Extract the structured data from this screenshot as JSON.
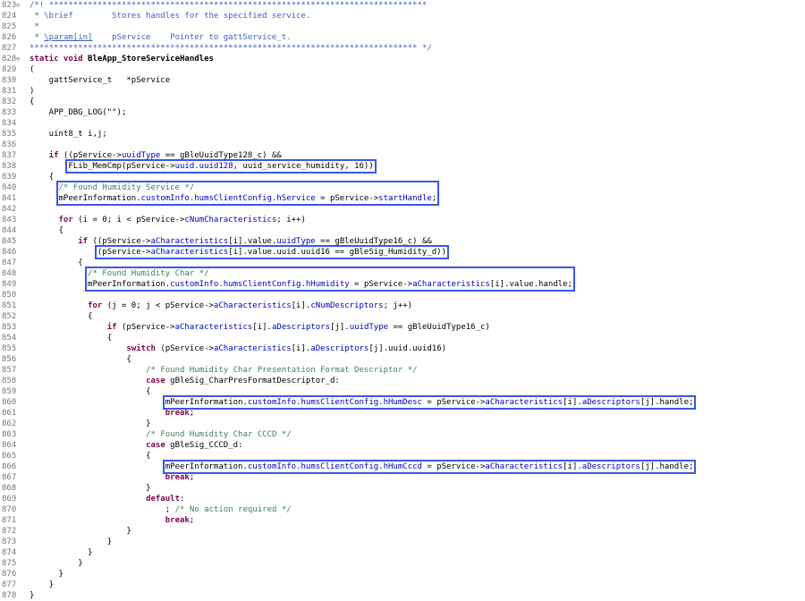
{
  "editor": {
    "lines": [
      {
        "n": "823",
        "fold": true,
        "indent": 0,
        "tokens": [
          {
            "t": "/*! ******************************************************************************",
            "c": "cmb"
          }
        ]
      },
      {
        "n": "824",
        "indent": 0,
        "tokens": [
          {
            "t": " * \\brief        Stores handles for the specified service.",
            "c": "cmb"
          }
        ]
      },
      {
        "n": "825",
        "indent": 0,
        "tokens": [
          {
            "t": " *",
            "c": "cmb"
          }
        ]
      },
      {
        "n": "826",
        "indent": 0,
        "tokens": [
          {
            "t": " * ",
            "c": "cmb"
          },
          {
            "t": "\\param[in]",
            "c": "cmb ul"
          },
          {
            "t": "    pService    Pointer to gattService_t.",
            "c": "cmb"
          }
        ]
      },
      {
        "n": "827",
        "indent": 0,
        "tokens": [
          {
            "t": "******************************************************************************** */",
            "c": "cmb"
          }
        ]
      },
      {
        "n": "828",
        "fold": true,
        "indent": 0,
        "tokens": [
          {
            "t": "static void ",
            "c": "kw"
          },
          {
            "t": "BleApp_StoreServiceHandles",
            "c": "bld"
          }
        ]
      },
      {
        "n": "829",
        "indent": 0,
        "tokens": [
          {
            "t": "("
          }
        ]
      },
      {
        "n": "830",
        "indent": 4,
        "tokens": [
          {
            "t": "gattService_t   *pService"
          }
        ]
      },
      {
        "n": "831",
        "indent": 0,
        "tokens": [
          {
            "t": ")"
          }
        ]
      },
      {
        "n": "832",
        "indent": 0,
        "tokens": [
          {
            "t": "{"
          }
        ]
      },
      {
        "n": "833",
        "indent": 4,
        "tokens": [
          {
            "t": "APP_DBG_LOG(\"\");"
          }
        ]
      },
      {
        "n": "834",
        "indent": 0,
        "tokens": []
      },
      {
        "n": "835",
        "indent": 4,
        "tokens": [
          {
            "t": "uint8_t i,j;"
          }
        ]
      },
      {
        "n": "836",
        "indent": 0,
        "tokens": []
      },
      {
        "n": "837",
        "indent": 4,
        "tokens": [
          {
            "t": "if",
            "c": "kw"
          },
          {
            "t": " ((pService->"
          },
          {
            "t": "uuidType",
            "c": "fld"
          },
          {
            "t": " == gBleUuidType128_c) &&"
          }
        ]
      },
      {
        "n": "838",
        "indent": 8,
        "tokens": [
          {
            "t": "FLib_MemCmp(pService->"
          },
          {
            "t": "uuid.uuid128",
            "c": "fld"
          },
          {
            "t": ", uuid_service_humidity, 16))"
          }
        ]
      },
      {
        "n": "839",
        "indent": 4,
        "tokens": [
          {
            "t": "{"
          }
        ]
      },
      {
        "n": "840",
        "indent": 6,
        "tokens": [
          {
            "t": "/* Found Humidity Service */",
            "c": "cm"
          }
        ]
      },
      {
        "n": "841",
        "indent": 6,
        "tokens": [
          {
            "t": "mPeerInformation."
          },
          {
            "t": "customInfo.humsClientConfig.hService",
            "c": "fld"
          },
          {
            "t": " = pService->"
          },
          {
            "t": "startHandle",
            "c": "fld"
          },
          {
            "t": ";"
          }
        ]
      },
      {
        "n": "842",
        "indent": 0,
        "tokens": []
      },
      {
        "n": "843",
        "indent": 6,
        "tokens": [
          {
            "t": "for",
            "c": "kw"
          },
          {
            "t": " (i = 0; i < pService->"
          },
          {
            "t": "cNumCharacteristics",
            "c": "fld"
          },
          {
            "t": "; i++)"
          }
        ]
      },
      {
        "n": "844",
        "indent": 6,
        "tokens": [
          {
            "t": "{"
          }
        ]
      },
      {
        "n": "845",
        "indent": 10,
        "tokens": [
          {
            "t": "if",
            "c": "kw"
          },
          {
            "t": " ((pService->"
          },
          {
            "t": "aCharacteristics",
            "c": "fld"
          },
          {
            "t": "[i].value."
          },
          {
            "t": "uuidType",
            "c": "fld"
          },
          {
            "t": " == gBleUuidType16_c) &&"
          }
        ]
      },
      {
        "n": "846",
        "indent": 14,
        "tokens": [
          {
            "t": "(pService->"
          },
          {
            "t": "aCharacteristics",
            "c": "fld"
          },
          {
            "t": "[i].value.uuid.uuid16 == gBleSig_Humidity_d))"
          }
        ]
      },
      {
        "n": "847",
        "indent": 10,
        "tokens": [
          {
            "t": "{"
          }
        ]
      },
      {
        "n": "848",
        "indent": 12,
        "tokens": [
          {
            "t": "/* Found Humidity Char */",
            "c": "cm"
          }
        ]
      },
      {
        "n": "849",
        "indent": 12,
        "tokens": [
          {
            "t": "mPeerInformation."
          },
          {
            "t": "customInfo.humsClientConfig.hHumidity",
            "c": "fld"
          },
          {
            "t": " = pService->"
          },
          {
            "t": "aCharacteristics",
            "c": "fld"
          },
          {
            "t": "[i].value.handle;"
          }
        ]
      },
      {
        "n": "850",
        "indent": 0,
        "tokens": []
      },
      {
        "n": "851",
        "indent": 12,
        "tokens": [
          {
            "t": "for",
            "c": "kw"
          },
          {
            "t": " (j = 0; j < pService->"
          },
          {
            "t": "aCharacteristics",
            "c": "fld"
          },
          {
            "t": "[i]."
          },
          {
            "t": "cNumDescriptors",
            "c": "fld"
          },
          {
            "t": "; j++)"
          }
        ]
      },
      {
        "n": "852",
        "indent": 12,
        "tokens": [
          {
            "t": "{"
          }
        ]
      },
      {
        "n": "853",
        "indent": 16,
        "tokens": [
          {
            "t": "if",
            "c": "kw"
          },
          {
            "t": " (pService->"
          },
          {
            "t": "aCharacteristics",
            "c": "fld"
          },
          {
            "t": "[i]."
          },
          {
            "t": "aDescriptors",
            "c": "fld"
          },
          {
            "t": "[j]."
          },
          {
            "t": "uuidType",
            "c": "fld"
          },
          {
            "t": " == gBleUuidType16_c)"
          }
        ]
      },
      {
        "n": "854",
        "indent": 16,
        "tokens": [
          {
            "t": "{"
          }
        ]
      },
      {
        "n": "855",
        "indent": 20,
        "tokens": [
          {
            "t": "switch",
            "c": "kw"
          },
          {
            "t": " (pService->"
          },
          {
            "t": "aCharacteristics",
            "c": "fld"
          },
          {
            "t": "[i]."
          },
          {
            "t": "aDescriptors",
            "c": "fld"
          },
          {
            "t": "[j].uuid.uuid16)"
          }
        ]
      },
      {
        "n": "856",
        "indent": 20,
        "tokens": [
          {
            "t": "{"
          }
        ]
      },
      {
        "n": "857",
        "indent": 24,
        "tokens": [
          {
            "t": "/* Found Humidity Char Presentation Format Descriptor */",
            "c": "cm"
          }
        ]
      },
      {
        "n": "858",
        "indent": 24,
        "tokens": [
          {
            "t": "case",
            "c": "kw"
          },
          {
            "t": " gBleSig_CharPresFormatDescriptor_d:"
          }
        ]
      },
      {
        "n": "859",
        "indent": 24,
        "tokens": [
          {
            "t": "{"
          }
        ]
      },
      {
        "n": "860",
        "indent": 28,
        "tokens": [
          {
            "t": "mPeerInformation."
          },
          {
            "t": "customInfo.humsClientConfig.hHumDesc",
            "c": "fld"
          },
          {
            "t": " = pService->"
          },
          {
            "t": "aCharacteristics",
            "c": "fld"
          },
          {
            "t": "[i]."
          },
          {
            "t": "aDescriptors",
            "c": "fld"
          },
          {
            "t": "[j].handle;"
          }
        ]
      },
      {
        "n": "861",
        "indent": 28,
        "tokens": [
          {
            "t": "break",
            "c": "kw"
          },
          {
            "t": ";"
          }
        ]
      },
      {
        "n": "862",
        "indent": 24,
        "tokens": [
          {
            "t": "}"
          }
        ]
      },
      {
        "n": "863",
        "indent": 24,
        "tokens": [
          {
            "t": "/* Found Humidity Char CCCD */",
            "c": "cm"
          }
        ]
      },
      {
        "n": "864",
        "indent": 24,
        "tokens": [
          {
            "t": "case",
            "c": "kw"
          },
          {
            "t": " gBleSig_CCCD_d:"
          }
        ]
      },
      {
        "n": "865",
        "indent": 24,
        "tokens": [
          {
            "t": "{"
          }
        ]
      },
      {
        "n": "866",
        "indent": 28,
        "tokens": [
          {
            "t": "mPeerInformation."
          },
          {
            "t": "customInfo.humsClientConfig.hHumCccd",
            "c": "fld"
          },
          {
            "t": " = pService->"
          },
          {
            "t": "aCharacteristics",
            "c": "fld"
          },
          {
            "t": "[i]."
          },
          {
            "t": "aDescriptors",
            "c": "fld"
          },
          {
            "t": "[j].handle;"
          }
        ]
      },
      {
        "n": "867",
        "indent": 28,
        "tokens": [
          {
            "t": "break",
            "c": "kw"
          },
          {
            "t": ";"
          }
        ]
      },
      {
        "n": "868",
        "indent": 24,
        "tokens": [
          {
            "t": "}"
          }
        ]
      },
      {
        "n": "869",
        "indent": 24,
        "tokens": [
          {
            "t": "default",
            "c": "kw"
          },
          {
            "t": ":"
          }
        ]
      },
      {
        "n": "870",
        "indent": 28,
        "tokens": [
          {
            "t": "; "
          },
          {
            "t": "/* No action required */",
            "c": "cm"
          }
        ]
      },
      {
        "n": "871",
        "indent": 28,
        "tokens": [
          {
            "t": "break",
            "c": "kw"
          },
          {
            "t": ";"
          }
        ]
      },
      {
        "n": "872",
        "indent": 20,
        "tokens": [
          {
            "t": "}"
          }
        ]
      },
      {
        "n": "873",
        "indent": 16,
        "tokens": [
          {
            "t": "}"
          }
        ]
      },
      {
        "n": "874",
        "indent": 12,
        "tokens": [
          {
            "t": "}"
          }
        ]
      },
      {
        "n": "875",
        "indent": 10,
        "tokens": [
          {
            "t": "}"
          }
        ]
      },
      {
        "n": "876",
        "indent": 6,
        "tokens": [
          {
            "t": "}"
          }
        ]
      },
      {
        "n": "877",
        "indent": 4,
        "tokens": [
          {
            "t": "}"
          }
        ]
      },
      {
        "n": "878",
        "indent": 0,
        "tokens": [
          {
            "t": "}"
          }
        ]
      }
    ],
    "highlights": [
      {
        "line": "838",
        "label": "memcmp-highlight"
      },
      {
        "line": "840",
        "label": "found-service-highlight"
      },
      {
        "line": "846",
        "label": "uuid16-highlight"
      },
      {
        "line": "848",
        "label": "found-char-highlight"
      },
      {
        "line": "860",
        "label": "humdesc-highlight"
      },
      {
        "line": "866",
        "label": "humcccd-highlight"
      }
    ],
    "highlight_color": "#3a57e8",
    "colors": {
      "keyword": "#7f0055",
      "comment": "#3f7f5f",
      "doc_comment": "#3f5fbf",
      "field": "#0000c0",
      "line_number": "#787878"
    }
  }
}
